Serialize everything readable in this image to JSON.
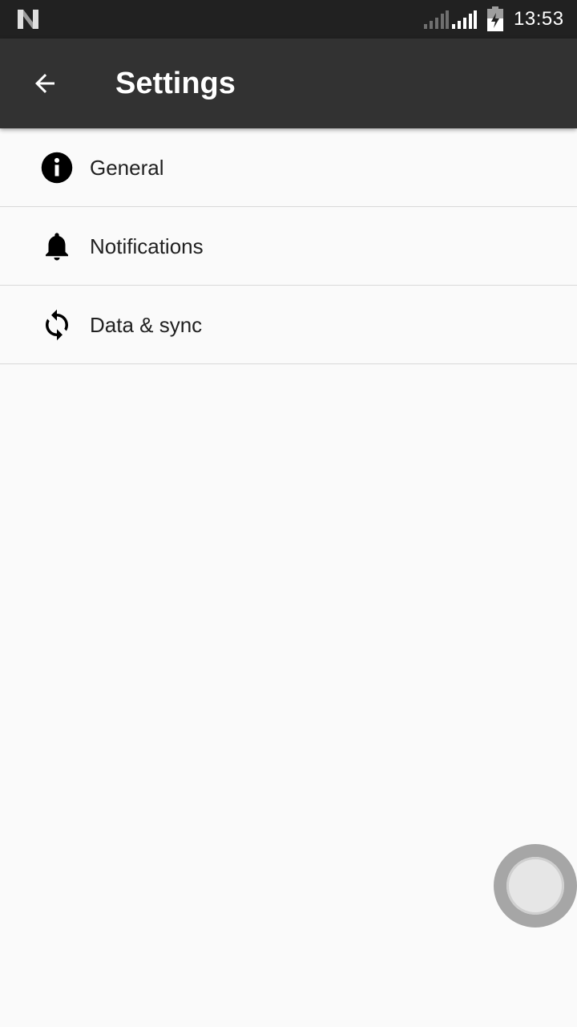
{
  "status_bar": {
    "time": "13:53",
    "icons": [
      "n-logo-icon",
      "signal-strength-icon",
      "signal-strength-icon",
      "battery-charging-icon"
    ]
  },
  "app_bar": {
    "title": "Settings",
    "back_icon": "arrow-back-icon"
  },
  "settings": {
    "items": [
      {
        "label": "General",
        "icon": "info-icon"
      },
      {
        "label": "Notifications",
        "icon": "bell-icon"
      },
      {
        "label": "Data & sync",
        "icon": "sync-icon"
      }
    ]
  },
  "colors": {
    "status_bar_bg": "#212121",
    "app_bar_bg": "#323232",
    "background": "#fafafa",
    "divider": "#d9d9d9",
    "text": "#212121"
  }
}
